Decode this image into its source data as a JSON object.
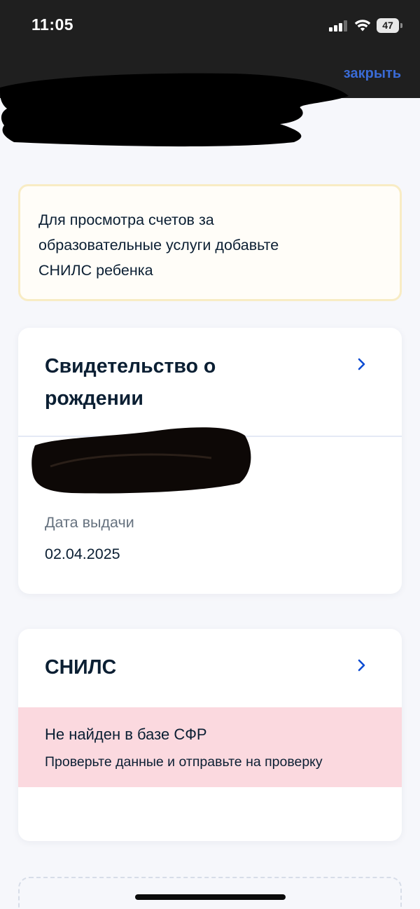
{
  "status_bar": {
    "time": "11:05",
    "battery": "47"
  },
  "header": {
    "close_label": "закрыть"
  },
  "notice": {
    "text": "Для просмотра счетов за\nобразовательные услуги добавьте\nСНИЛС ребенка"
  },
  "birth_certificate": {
    "title": "Свидетельство о\nрождении",
    "issue_date_label": "Дата выдачи",
    "issue_date_value": "02.04.2025"
  },
  "snils": {
    "title": "СНИЛС",
    "error_title": "Не найден в базе СФР",
    "error_subtitle": "Проверьте данные и отправьте на проверку"
  },
  "colors": {
    "link": "#3a6bd6",
    "error_background": "#fbd9df",
    "notice_border": "#f8ecc4"
  }
}
